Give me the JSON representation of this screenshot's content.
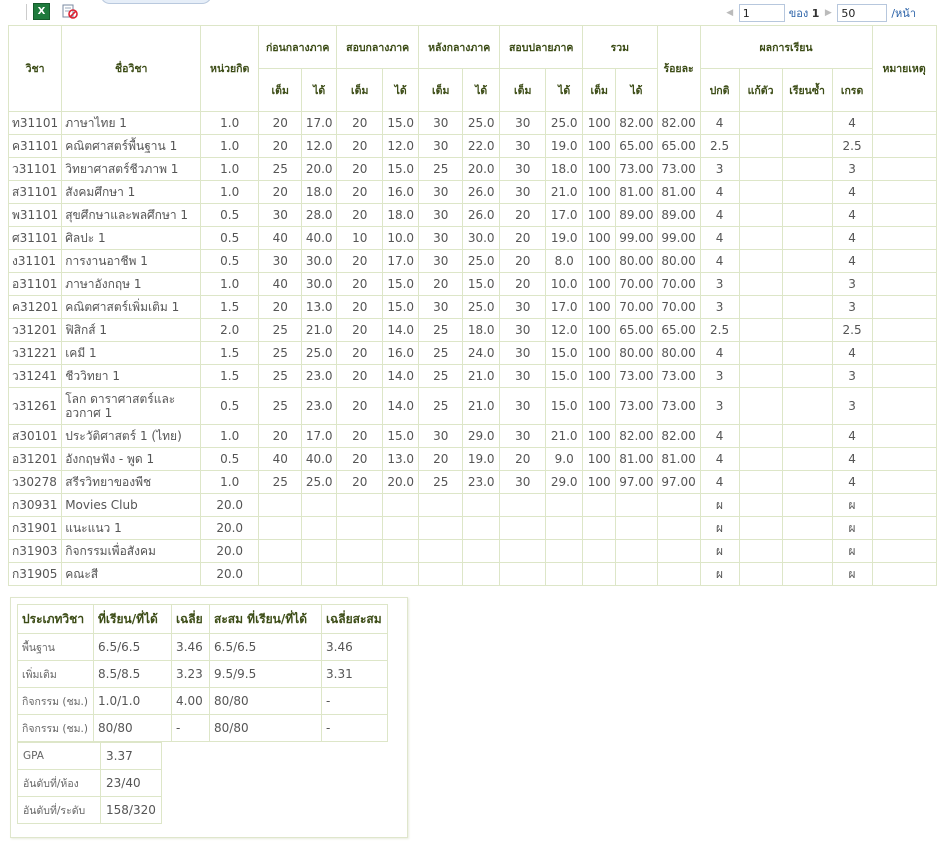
{
  "toolbar": {
    "excel_icon": "excel-export-icon",
    "noprint_icon": "no-print-icon",
    "page_value": "1",
    "of_label": "ของ",
    "total_pages": "1",
    "page_size": "50",
    "per_page_label": "/หน้า"
  },
  "headers": {
    "code": "วิชา",
    "name": "ชื่อวิชา",
    "credit": "หน่วยกิต",
    "midterm_before": "ก่อนกลางภาค",
    "midterm": "สอบกลางภาค",
    "after_mid": "หลังกลางภาค",
    "final": "สอบปลายภาค",
    "total": "รวม",
    "percent": "ร้อยละ",
    "result": "ผลการเรียน",
    "remark": "หมายเหตุ",
    "full": "เต็ม",
    "got": "ได้",
    "normal": "ปกติ",
    "fixed": "แก้ตัว",
    "repeat": "เรียนซ้ำ",
    "grade": "เกรด"
  },
  "rows": [
    {
      "code": "ท31101",
      "name": "ภาษาไทย 1",
      "credit": "1.0",
      "f1": "20",
      "g1": "17.0",
      "f2": "20",
      "g2": "15.0",
      "f3": "30",
      "g3": "25.0",
      "f4": "30",
      "g4": "25.0",
      "tf": "100",
      "tg": "82.00",
      "pct": "82.00",
      "normal": "4",
      "fix": "",
      "rep": "",
      "grade": "4"
    },
    {
      "code": "ค31101",
      "name": "คณิตศาสตร์พื้นฐาน 1",
      "credit": "1.0",
      "f1": "20",
      "g1": "12.0",
      "f2": "20",
      "g2": "12.0",
      "f3": "30",
      "g3": "22.0",
      "f4": "30",
      "g4": "19.0",
      "tf": "100",
      "tg": "65.00",
      "pct": "65.00",
      "normal": "2.5",
      "fix": "",
      "rep": "",
      "grade": "2.5"
    },
    {
      "code": "ว31101",
      "name": "วิทยาศาสตร์ชีวภาพ 1",
      "credit": "1.0",
      "f1": "25",
      "g1": "20.0",
      "f2": "20",
      "g2": "15.0",
      "f3": "25",
      "g3": "20.0",
      "f4": "30",
      "g4": "18.0",
      "tf": "100",
      "tg": "73.00",
      "pct": "73.00",
      "normal": "3",
      "fix": "",
      "rep": "",
      "grade": "3"
    },
    {
      "code": "ส31101",
      "name": "สังคมศึกษา 1",
      "credit": "1.0",
      "f1": "20",
      "g1": "18.0",
      "f2": "20",
      "g2": "16.0",
      "f3": "30",
      "g3": "26.0",
      "f4": "30",
      "g4": "21.0",
      "tf": "100",
      "tg": "81.00",
      "pct": "81.00",
      "normal": "4",
      "fix": "",
      "rep": "",
      "grade": "4"
    },
    {
      "code": "พ31101",
      "name": "สุขศึกษาและพลศึกษา 1",
      "credit": "0.5",
      "f1": "30",
      "g1": "28.0",
      "f2": "20",
      "g2": "18.0",
      "f3": "30",
      "g3": "26.0",
      "f4": "20",
      "g4": "17.0",
      "tf": "100",
      "tg": "89.00",
      "pct": "89.00",
      "normal": "4",
      "fix": "",
      "rep": "",
      "grade": "4"
    },
    {
      "code": "ศ31101",
      "name": "ศิลปะ 1",
      "credit": "0.5",
      "f1": "40",
      "g1": "40.0",
      "f2": "10",
      "g2": "10.0",
      "f3": "30",
      "g3": "30.0",
      "f4": "20",
      "g4": "19.0",
      "tf": "100",
      "tg": "99.00",
      "pct": "99.00",
      "normal": "4",
      "fix": "",
      "rep": "",
      "grade": "4"
    },
    {
      "code": "ง31101",
      "name": "การงานอาชีพ 1",
      "credit": "0.5",
      "f1": "30",
      "g1": "30.0",
      "f2": "20",
      "g2": "17.0",
      "f3": "30",
      "g3": "25.0",
      "f4": "20",
      "g4": "8.0",
      "tf": "100",
      "tg": "80.00",
      "pct": "80.00",
      "normal": "4",
      "fix": "",
      "rep": "",
      "grade": "4"
    },
    {
      "code": "อ31101",
      "name": "ภาษาอังกฤษ 1",
      "credit": "1.0",
      "f1": "40",
      "g1": "30.0",
      "f2": "20",
      "g2": "15.0",
      "f3": "20",
      "g3": "15.0",
      "f4": "20",
      "g4": "10.0",
      "tf": "100",
      "tg": "70.00",
      "pct": "70.00",
      "normal": "3",
      "fix": "",
      "rep": "",
      "grade": "3"
    },
    {
      "code": "ค31201",
      "name": "คณิตศาสตร์เพิ่มเติม 1",
      "credit": "1.5",
      "f1": "20",
      "g1": "13.0",
      "f2": "20",
      "g2": "15.0",
      "f3": "30",
      "g3": "25.0",
      "f4": "30",
      "g4": "17.0",
      "tf": "100",
      "tg": "70.00",
      "pct": "70.00",
      "normal": "3",
      "fix": "",
      "rep": "",
      "grade": "3"
    },
    {
      "code": "ว31201",
      "name": "ฟิสิกส์ 1",
      "credit": "2.0",
      "f1": "25",
      "g1": "21.0",
      "f2": "20",
      "g2": "14.0",
      "f3": "25",
      "g3": "18.0",
      "f4": "30",
      "g4": "12.0",
      "tf": "100",
      "tg": "65.00",
      "pct": "65.00",
      "normal": "2.5",
      "fix": "",
      "rep": "",
      "grade": "2.5"
    },
    {
      "code": "ว31221",
      "name": "เคมี 1",
      "credit": "1.5",
      "f1": "25",
      "g1": "25.0",
      "f2": "20",
      "g2": "16.0",
      "f3": "25",
      "g3": "24.0",
      "f4": "30",
      "g4": "15.0",
      "tf": "100",
      "tg": "80.00",
      "pct": "80.00",
      "normal": "4",
      "fix": "",
      "rep": "",
      "grade": "4"
    },
    {
      "code": "ว31241",
      "name": "ชีววิทยา 1",
      "credit": "1.5",
      "f1": "25",
      "g1": "23.0",
      "f2": "20",
      "g2": "14.0",
      "f3": "25",
      "g3": "21.0",
      "f4": "30",
      "g4": "15.0",
      "tf": "100",
      "tg": "73.00",
      "pct": "73.00",
      "normal": "3",
      "fix": "",
      "rep": "",
      "grade": "3"
    },
    {
      "code": "ว31261",
      "name": "โลก ดาราศาสตร์และอวกาศ 1",
      "credit": "0.5",
      "f1": "25",
      "g1": "23.0",
      "f2": "20",
      "g2": "14.0",
      "f3": "25",
      "g3": "21.0",
      "f4": "30",
      "g4": "15.0",
      "tf": "100",
      "tg": "73.00",
      "pct": "73.00",
      "normal": "3",
      "fix": "",
      "rep": "",
      "grade": "3",
      "tall": true
    },
    {
      "code": "ส30101",
      "name": "ประวัติศาสตร์ 1 (ไทย)",
      "credit": "1.0",
      "f1": "20",
      "g1": "17.0",
      "f2": "20",
      "g2": "15.0",
      "f3": "30",
      "g3": "29.0",
      "f4": "30",
      "g4": "21.0",
      "tf": "100",
      "tg": "82.00",
      "pct": "82.00",
      "normal": "4",
      "fix": "",
      "rep": "",
      "grade": "4"
    },
    {
      "code": "อ31201",
      "name": "อังกฤษฟัง - พูด 1",
      "credit": "0.5",
      "f1": "40",
      "g1": "40.0",
      "f2": "20",
      "g2": "13.0",
      "f3": "20",
      "g3": "19.0",
      "f4": "20",
      "g4": "9.0",
      "tf": "100",
      "tg": "81.00",
      "pct": "81.00",
      "normal": "4",
      "fix": "",
      "rep": "",
      "grade": "4"
    },
    {
      "code": "ว30278",
      "name": "สรีรวิทยาของพืช",
      "credit": "1.0",
      "f1": "25",
      "g1": "25.0",
      "f2": "20",
      "g2": "20.0",
      "f3": "25",
      "g3": "23.0",
      "f4": "30",
      "g4": "29.0",
      "tf": "100",
      "tg": "97.00",
      "pct": "97.00",
      "normal": "4",
      "fix": "",
      "rep": "",
      "grade": "4"
    },
    {
      "code": "ก30931",
      "name": "Movies Club",
      "credit": "20.0",
      "f1": "",
      "g1": "",
      "f2": "",
      "g2": "",
      "f3": "",
      "g3": "",
      "f4": "",
      "g4": "",
      "tf": "",
      "tg": "",
      "pct": "",
      "normal": "ผ",
      "fix": "",
      "rep": "",
      "grade": "ผ"
    },
    {
      "code": "ก31901",
      "name": "แนะแนว 1",
      "credit": "20.0",
      "f1": "",
      "g1": "",
      "f2": "",
      "g2": "",
      "f3": "",
      "g3": "",
      "f4": "",
      "g4": "",
      "tf": "",
      "tg": "",
      "pct": "",
      "normal": "ผ",
      "fix": "",
      "rep": "",
      "grade": "ผ"
    },
    {
      "code": "ก31903",
      "name": "กิจกรรมเพื่อสังคม",
      "credit": "20.0",
      "f1": "",
      "g1": "",
      "f2": "",
      "g2": "",
      "f3": "",
      "g3": "",
      "f4": "",
      "g4": "",
      "tf": "",
      "tg": "",
      "pct": "",
      "normal": "ผ",
      "fix": "",
      "rep": "",
      "grade": "ผ"
    },
    {
      "code": "ก31905",
      "name": "คณะสี",
      "credit": "20.0",
      "f1": "",
      "g1": "",
      "f2": "",
      "g2": "",
      "f3": "",
      "g3": "",
      "f4": "",
      "g4": "",
      "tf": "",
      "tg": "",
      "pct": "",
      "normal": "ผ",
      "fix": "",
      "rep": "",
      "grade": "ผ"
    }
  ],
  "summary": {
    "headers": [
      "ประเภทวิชา",
      "ที่เรียน/ที่ได้",
      "เฉลี่ย",
      "สะสม ที่เรียน/ที่ได้",
      "เฉลี่ยสะสม"
    ],
    "rows": [
      [
        "พื้นฐาน",
        "6.5/6.5",
        "3.46",
        "6.5/6.5",
        "3.46"
      ],
      [
        "เพิ่มเติม",
        "8.5/8.5",
        "3.23",
        "9.5/9.5",
        "3.31"
      ],
      [
        "กิจกรรม (ชม.)",
        "1.0/1.0",
        "4.00",
        "80/80",
        "-"
      ],
      [
        "กิจกรรม (ชม.)",
        "80/80",
        "-",
        "80/80",
        "-"
      ]
    ]
  },
  "gpa": {
    "rows": [
      [
        "GPA",
        "3.37"
      ],
      [
        "อันดับที่/ห้อง",
        "23/40"
      ],
      [
        "อันดับที่/ระดับ",
        "158/320"
      ]
    ]
  }
}
